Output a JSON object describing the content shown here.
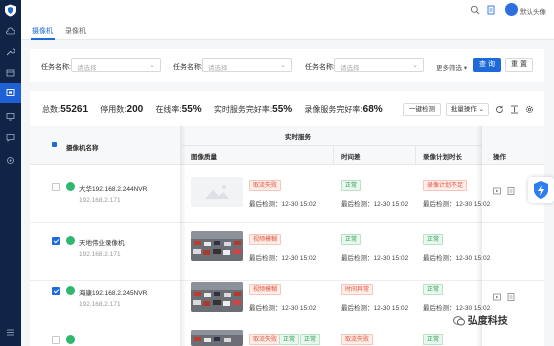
{
  "header": {
    "username": "默认头像"
  },
  "tabs": [
    {
      "label": "摄像机"
    },
    {
      "label": "录像机"
    }
  ],
  "filters": {
    "items": [
      {
        "label": "任务名称:",
        "placeholder": "请选择"
      },
      {
        "label": "任务名称:",
        "placeholder": "请选择"
      },
      {
        "label": "任务名称:",
        "placeholder": "请选择"
      }
    ],
    "more": "更多筛选",
    "query": "查 询",
    "reset": "重 置"
  },
  "stats": {
    "total_label": "总数:",
    "total": "55261",
    "disabled_label": "停用数:",
    "disabled": "200",
    "online_label": "在线率:",
    "online": "55%",
    "realtime_label": "实时服务完好率:",
    "realtime": "55%",
    "record_label": "录像服务完好率:",
    "record": "68%"
  },
  "toolbar": {
    "one_click_check": "一键检测",
    "batch": "批量操作",
    "batch_chevron": "⌄"
  },
  "table": {
    "col_name": "摄像机名称",
    "group_realtime": "实时服务",
    "col_quality": "图像质量",
    "col_time_diff": "时间差",
    "col_record_plan": "录像计划时长",
    "col_action": "操作",
    "rows": [
      {
        "checked": false,
        "name": "大华192.168.2.244NVR",
        "ip": "192.168.2.171",
        "thumb": "blank",
        "quality_tags": [
          "取流失败"
        ],
        "quality_last": "最后检测：12-30 15:02",
        "time_tags": [
          "正常"
        ],
        "time_last": "最后检测：12-30 15:02",
        "record_tags": [
          "录像计划不足"
        ],
        "record_last": "最后检测：12-30 15:02"
      },
      {
        "checked": true,
        "name": "天地伟业录像机",
        "ip": "192.168.2.171",
        "thumb": "traffic",
        "quality_tags": [
          "视频模糊"
        ],
        "quality_last": "最后检测：12-30 15:02",
        "time_tags": [
          "正常"
        ],
        "time_last": "最后检测：12-30 15:02",
        "record_tags": [
          "正常"
        ],
        "record_last": "最后检测：12-30 15:02"
      },
      {
        "checked": true,
        "name": "海康192.168.2.245NVR",
        "ip": "192.168.2.171",
        "thumb": "traffic",
        "quality_tags": [
          "视频模糊"
        ],
        "quality_last": "最后检测：12-30 15:02",
        "time_tags": [
          "时间异常"
        ],
        "time_last": "最后检测：12-30 15:02",
        "record_tags": [
          "正常"
        ],
        "record_last": "最后检测：12-30 15:02"
      },
      {
        "checked": false,
        "name": "",
        "ip": "",
        "thumb": "traffic",
        "quality_tags": [
          "取流失败",
          "正常",
          "正常"
        ],
        "quality_last": "",
        "time_tags": [
          "取流失败"
        ],
        "time_last": "",
        "record_tags": [
          "正常"
        ],
        "record_last": ""
      }
    ]
  },
  "watermark": "弘度科技",
  "colors": {
    "primary": "#1e6ad9",
    "sidebar": "#0f2446",
    "danger": "#e0533b",
    "success": "#2a9f57"
  }
}
